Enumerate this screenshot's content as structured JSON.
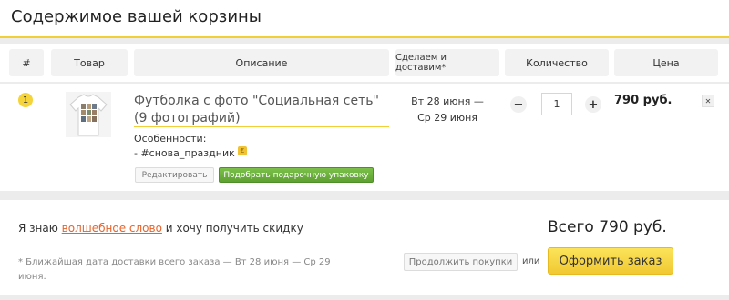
{
  "page_title": "Содержимое вашей корзины",
  "columns": {
    "num": "#",
    "product": "Товар",
    "description": "Описание",
    "delivery": "Сделаем и доставим*",
    "quantity": "Количество",
    "price": "Цена"
  },
  "item": {
    "index": "1",
    "name": "Футболка с фото \"Социальная сеть\" (9 фотографий)",
    "features_label": "Особенности:",
    "feature": "- #снова_праздник",
    "edit_label": "Редактировать",
    "gift_label": "Подобрать подарочную упаковку",
    "delivery_line1": "Вт 28 июня —",
    "delivery_line2": "Ср 29 июня",
    "quantity": "1",
    "minus": "−",
    "plus": "+",
    "price": "790 руб.",
    "remove": "✕"
  },
  "footer": {
    "promo_before": "Я знаю ",
    "promo_link": "волшебное слово",
    "promo_after": " и хочу получить скидку",
    "note": "* Ближайшая дата доставки всего заказа — Вт 28 июня — Ср 29 июня.",
    "total": "Всего 790 руб.",
    "continue_label": "Продолжить покупки",
    "or": "или",
    "checkout_label": "Оформить заказ"
  },
  "colors": {
    "accent_yellow": "#f1cf38",
    "green_button": "#5ea132",
    "link_orange": "#e8632a"
  }
}
